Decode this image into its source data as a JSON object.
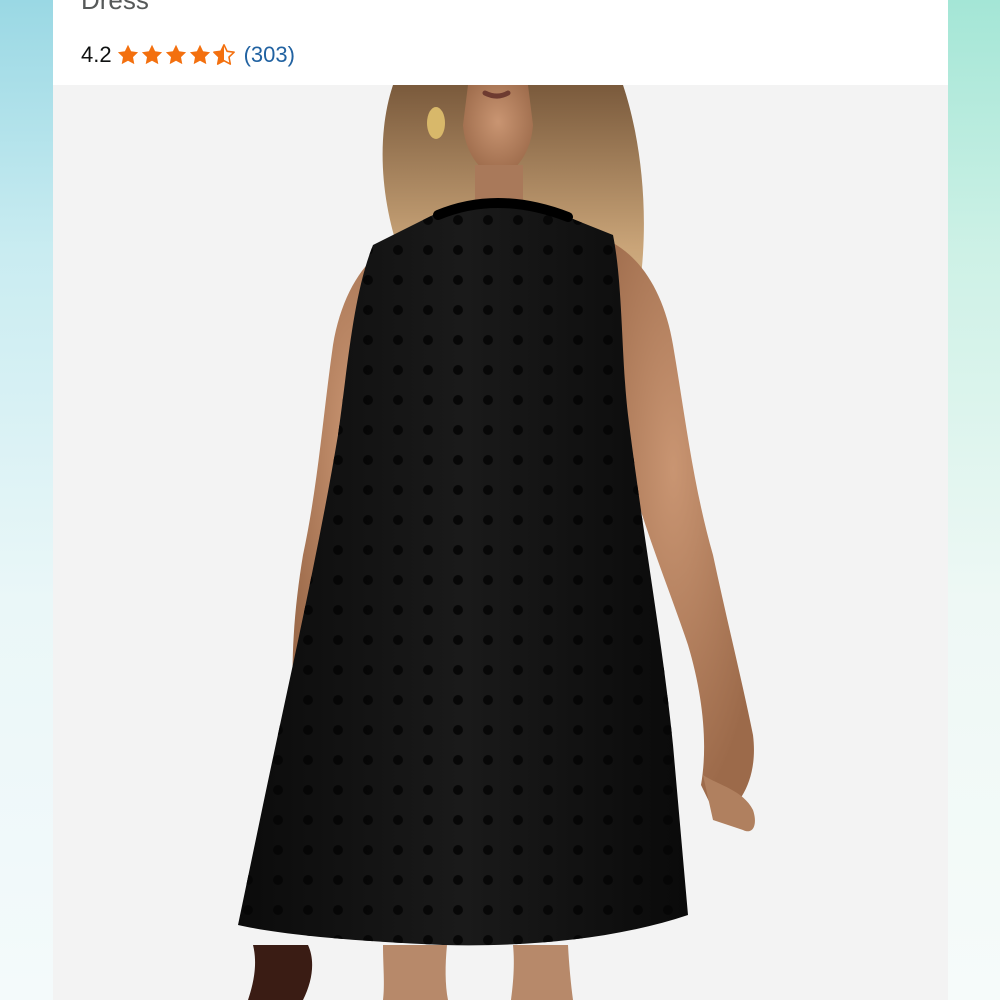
{
  "product": {
    "title_tail": "Dress",
    "rating_value": "4.2",
    "rating_stars": 4.2,
    "review_count": "(303)",
    "image_alt": "product-photo-black-halter-dress",
    "icons": [
      "star-icon",
      "star-half-icon"
    ]
  },
  "colors": {
    "star": "#f3700f",
    "review_link": "#2162a1",
    "image_bg": "#f3f3f3"
  }
}
